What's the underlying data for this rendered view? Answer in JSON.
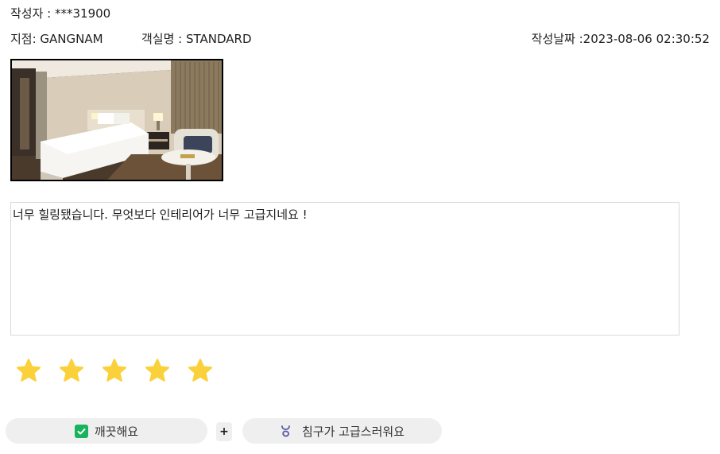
{
  "review": {
    "author": "작성자 : ***31900",
    "branch": "지점: GANGNAM",
    "room": "객실명 : STANDARD",
    "date": "작성날짜 :2023-08-06 02:30:52",
    "photo_alt": "hotel-room-photo",
    "text": "너무 힐링됐습니다. 무엇보다 인테리어가 너무 고급지네요 !",
    "rating": 5,
    "star_color": "#FBD13B"
  },
  "tags": {
    "clean": {
      "label": "깨끗해요",
      "icon": "check-icon",
      "icon_color": "#19B35C"
    },
    "plus_label": "+",
    "bedding": {
      "label": "침구가 고급스러워요",
      "icon": "bed-icon",
      "icon_color": "#5B5BA8"
    }
  }
}
